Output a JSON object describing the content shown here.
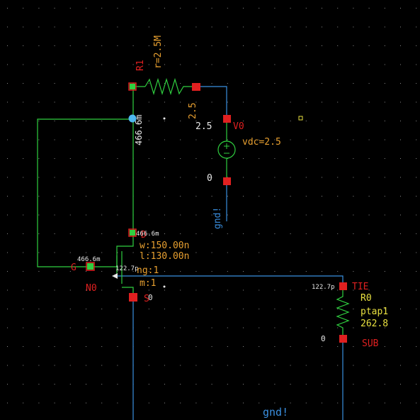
{
  "schematic": {
    "resistor_r1": {
      "instance_name": "R1",
      "param_text": "r=2.5M",
      "node_label": "466.6m"
    },
    "vsource_v0": {
      "instance_name": "V0",
      "param_text": "vdc=2.5",
      "top_terminal_label": "2.5",
      "top_voltage": "2.5",
      "bottom_voltage": "0",
      "ground_label": "gnd!"
    },
    "nmos_n0": {
      "instance_name": "N0",
      "drain_label": "D",
      "gate_label": "G",
      "source_label": "S",
      "drain_voltage": "466.6m",
      "gate_voltage": "466.6m",
      "bulk_voltage": "122.7p",
      "source_voltage": "0",
      "width": "w:150.00n",
      "length": "l:130.00n",
      "fingers": "ng:1",
      "multiplier": "m:1"
    },
    "substrate_r0": {
      "instance_name": "R0",
      "cell_name": "ptap1",
      "value": "262.8",
      "terminal_label": "TIE",
      "sub_label": "SUB",
      "top_voltage": "122.7p",
      "bottom_voltage": "0"
    },
    "bottom_ground_label": "gnd!"
  },
  "colors": {
    "background": "#000000",
    "grid_dot": "#8a8a8a",
    "wire": "#3a8fe0",
    "device": "#30d040",
    "pin": "#e02020",
    "label_orange": "#e8a030",
    "label_white": "#e8e8e8",
    "label_yellow": "#e8e040",
    "selected_node": "#4fb8f0"
  }
}
